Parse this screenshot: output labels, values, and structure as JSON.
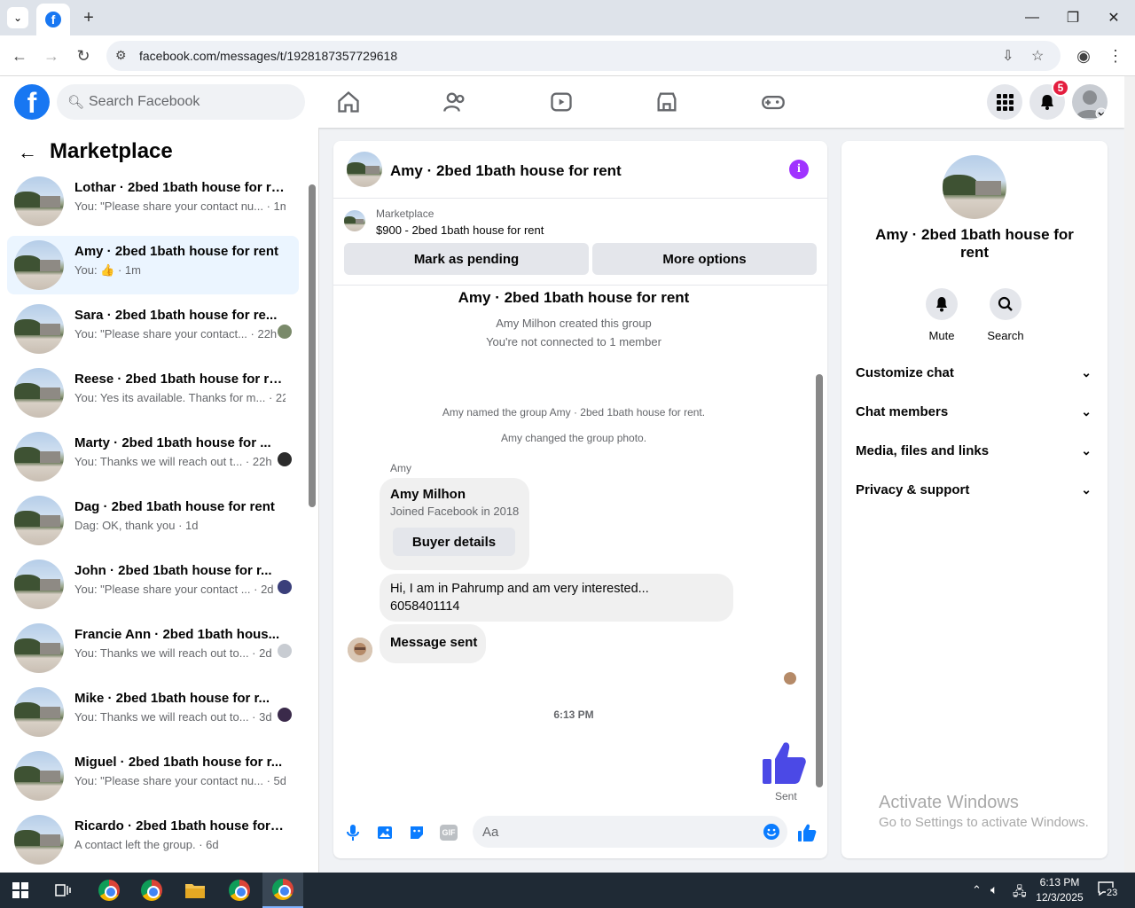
{
  "browser": {
    "url": "facebook.com/messages/t/1928187357729618",
    "window_controls": [
      "—",
      "❐",
      "✕"
    ]
  },
  "fb_header": {
    "search_placeholder": "Search Facebook",
    "notifications_count": "5"
  },
  "left": {
    "title": "Marketplace",
    "conversations": [
      {
        "name": "Lothar · 2bed 1bath house for rent",
        "snippet": "You: \"Please share your contact nu... · 1m"
      },
      {
        "name": "Amy · 2bed 1bath house for rent",
        "snippet": "You: 👍 · 1m"
      },
      {
        "name": "Sara · 2bed 1bath house for re...",
        "snippet": "You: \"Please share your contact... · 22h"
      },
      {
        "name": "Reese · 2bed 1bath house for rent",
        "snippet": "You: Yes its available. Thanks for m... · 22h"
      },
      {
        "name": "Marty · 2bed 1bath house for ...",
        "snippet": "You: Thanks we will reach out t... · 22h"
      },
      {
        "name": "Dag · 2bed 1bath house for rent",
        "snippet": "Dag: OK, thank you · 1d"
      },
      {
        "name": "John · 2bed 1bath house for r...",
        "snippet": "You: \"Please share your contact ... · 2d"
      },
      {
        "name": "Francie Ann · 2bed 1bath hous...",
        "snippet": "You: Thanks we will reach out to... · 2d"
      },
      {
        "name": "Mike · 2bed 1bath house for r...",
        "snippet": "You: Thanks we will reach out to... · 3d"
      },
      {
        "name": "Miguel · 2bed 1bath house for r...",
        "snippet": "You: \"Please share your contact nu... · 5d"
      },
      {
        "name": "Ricardo · 2bed 1bath house for r...",
        "snippet": "A contact left the group. · 6d"
      }
    ]
  },
  "chat": {
    "title": "Amy · 2bed 1bath house for rent",
    "marketplace_label": "Marketplace",
    "listing": "$900 - 2bed 1bath house for rent",
    "mark_pending": "Mark as pending",
    "more_options": "More options",
    "thread_title": "Amy · 2bed 1bath house for rent",
    "created": "Amy Milhon created this group",
    "not_connected": "You're not connected to 1 member",
    "named_group": "Amy named the group Amy · 2bed 1bath house for rent.",
    "changed_photo": "Amy changed the group photo.",
    "sender": "Amy",
    "card_name": "Amy Milhon",
    "card_sub": "Joined Facebook in 2018",
    "buyer_details": "Buyer details",
    "msg1_line1": "Hi, I am in Pahrump and am very interested...",
    "msg1_line2": "6058401114",
    "msg2": "Message sent",
    "timestamp": "6:13 PM",
    "sent": "Sent",
    "composer_placeholder": "Aa"
  },
  "right": {
    "title": "Amy · 2bed 1bath house for rent",
    "mute": "Mute",
    "search": "Search",
    "sections": [
      "Customize chat",
      "Chat members",
      "Media, files and links",
      "Privacy & support"
    ]
  },
  "watermark": {
    "line1": "Activate Windows",
    "line2": "Go to Settings to activate Windows."
  },
  "taskbar": {
    "time": "6:13 PM",
    "date": "12/3/2025",
    "notif_count": "23"
  }
}
